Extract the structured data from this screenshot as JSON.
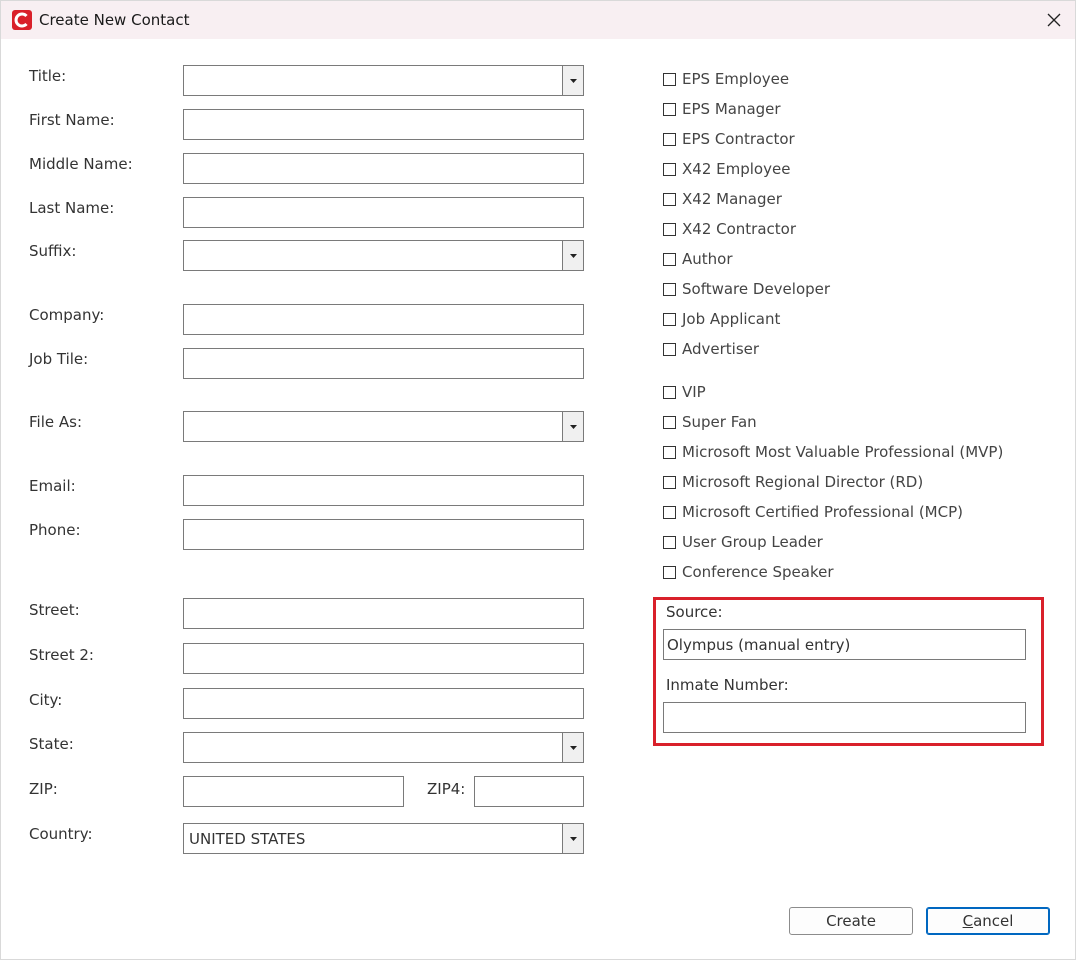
{
  "window": {
    "title": "Create New Contact",
    "app_icon": "app-logo-icon",
    "close_icon": "close-icon",
    "accent_color": "#d9202a"
  },
  "form": {
    "title_label": "Title:",
    "first_name_label": "First Name:",
    "middle_name_label": "Middle Name:",
    "last_name_label": "Last Name:",
    "suffix_label": "Suffix:",
    "company_label": "Company:",
    "job_title_label": "Job Tile:",
    "file_as_label": "File As:",
    "email_label": "Email:",
    "phone_label": "Phone:",
    "street_label": "Street:",
    "street2_label": "Street 2:",
    "city_label": "City:",
    "state_label": "State:",
    "zip_label": "ZIP:",
    "zip4_label": "ZIP4:",
    "country_label": "Country:",
    "country_value": "UNITED STATES"
  },
  "checkboxes": [
    {
      "label": "EPS Employee",
      "checked": false
    },
    {
      "label": "EPS Manager",
      "checked": false
    },
    {
      "label": "EPS Contractor",
      "checked": false
    },
    {
      "label": "X42 Employee",
      "checked": false
    },
    {
      "label": "X42 Manager",
      "checked": false
    },
    {
      "label": "X42 Contractor",
      "checked": false
    },
    {
      "label": "Author",
      "checked": false
    },
    {
      "label": "Software Developer",
      "checked": false
    },
    {
      "label": "Job Applicant",
      "checked": false
    },
    {
      "label": "Advertiser",
      "checked": false
    },
    {
      "label": "VIP",
      "checked": false
    },
    {
      "label": "Super Fan",
      "checked": false
    },
    {
      "label": "Microsoft Most Valuable Professional (MVP)",
      "checked": false
    },
    {
      "label": "Microsoft Regional Director (RD)",
      "checked": false
    },
    {
      "label": "Microsoft Certified Professional (MCP)",
      "checked": false
    },
    {
      "label": "User Group Leader",
      "checked": false
    },
    {
      "label": "Conference Speaker",
      "checked": false
    }
  ],
  "source_section": {
    "source_label": "Source:",
    "source_value": "Olympus (manual entry)",
    "inmate_label": "Inmate Number:",
    "inmate_value": ""
  },
  "buttons": {
    "create_label": "Create",
    "cancel_first": "C",
    "cancel_rest": "ancel"
  }
}
